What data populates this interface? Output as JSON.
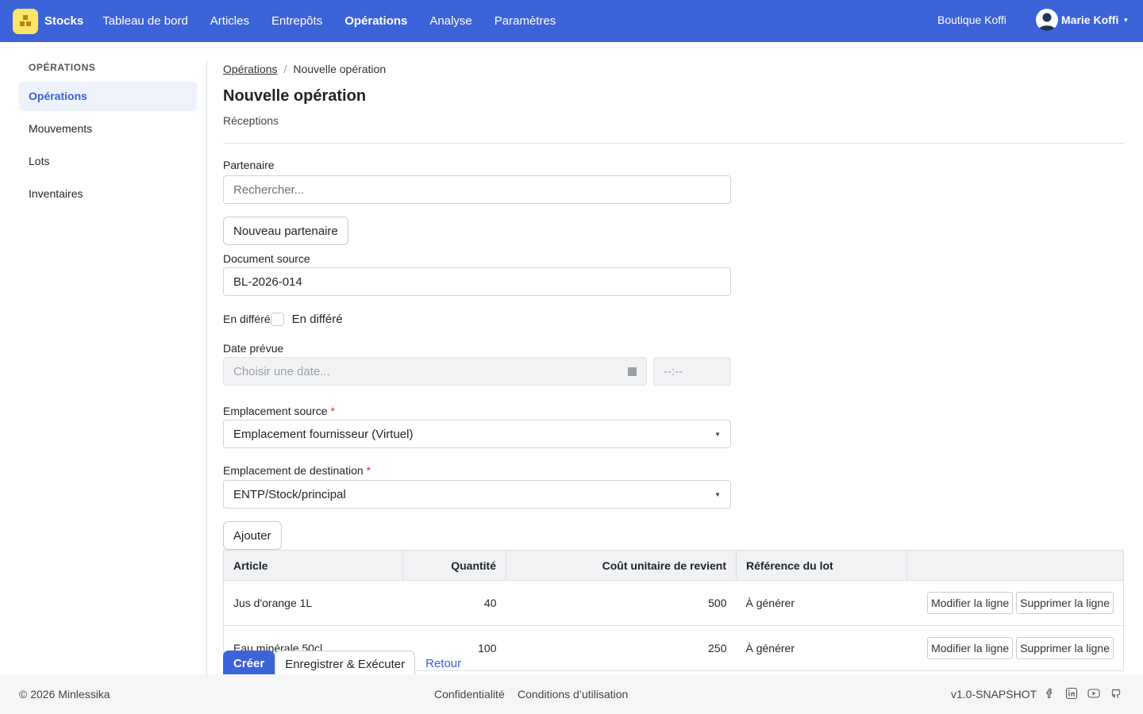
{
  "nav": {
    "brand": "Stocks",
    "items": [
      {
        "label": "Tableau de bord",
        "active": false
      },
      {
        "label": "Articles",
        "active": false
      },
      {
        "label": "Entrepôts",
        "active": false
      },
      {
        "label": "Opérations",
        "active": true
      },
      {
        "label": "Analyse",
        "active": false
      },
      {
        "label": "Paramètres",
        "active": false
      }
    ],
    "shop": "Boutique Koffi",
    "user": "Marie Koffi"
  },
  "sidebar": {
    "heading": "OPÉRATIONS",
    "items": [
      {
        "label": "Opérations",
        "active": true
      },
      {
        "label": "Mouvements",
        "active": false
      },
      {
        "label": "Lots",
        "active": false
      },
      {
        "label": "Inventaires",
        "active": false
      }
    ]
  },
  "breadcrumb": {
    "parent": "Opérations",
    "separator": "/",
    "current": "Nouvelle opération"
  },
  "page": {
    "title": "Nouvelle opération",
    "subtitle": "Réceptions"
  },
  "form": {
    "partner_label": "Partenaire",
    "partner_placeholder": "Rechercher...",
    "new_partner_button": "Nouveau partenaire",
    "source_doc_label": "Document source",
    "source_doc_value": "BL-2026-014",
    "deferred_label": "En différé",
    "deferred_checkbox_label": "En différé",
    "deferred_checked": false,
    "date_label": "Date prévue",
    "date_placeholder": "Choisir une date...",
    "time_placeholder": "--:--",
    "source_location_label": "Emplacement source",
    "source_location_value": "Emplacement fournisseur (Virtuel)",
    "dest_location_label": "Emplacement de destination",
    "dest_location_value": "ENTP/Stock/principal",
    "required_mark": "*",
    "add_button": "Ajouter"
  },
  "table": {
    "headers": [
      "Article",
      "Quantité",
      "Coût unitaire de revient",
      "Référence du lot",
      ""
    ],
    "rows": [
      {
        "article": "Jus d'orange 1L",
        "qty": "40",
        "cost": "500",
        "lot": "À générer",
        "edit": "Modifier la ligne",
        "delete": "Supprimer la ligne"
      },
      {
        "article": "Eau minérale 50cl",
        "qty": "100",
        "cost": "250",
        "lot": "À générer",
        "edit": "Modifier la ligne",
        "delete": "Supprimer la ligne"
      }
    ]
  },
  "actions": {
    "create": "Créer",
    "save_execute": "Enregistrer & Exécuter",
    "back": "Retour"
  },
  "footer": {
    "copyright": "© 2026 Minlessika",
    "privacy": "Confidentialité",
    "terms": "Conditions d’utilisation",
    "version": "v1.0-SNAPSHOT",
    "social_icons": [
      "facebook-icon",
      "linkedin-icon",
      "youtube-icon",
      "github-icon"
    ]
  },
  "colors": {
    "primary": "#3d63d9",
    "logo": "#ffe46b",
    "required": "#d93025"
  }
}
